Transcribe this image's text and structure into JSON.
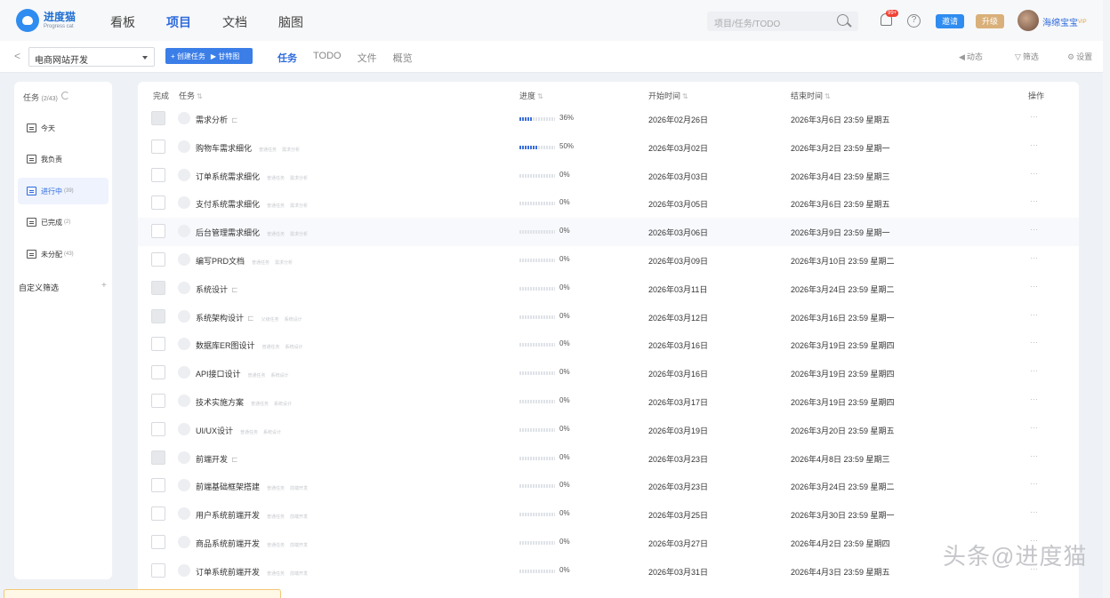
{
  "app": {
    "logo_cn": "进度猫",
    "logo_en": "Progress cat"
  },
  "nav": {
    "items": [
      {
        "label": "看板",
        "active": false
      },
      {
        "label": "项目",
        "active": true
      },
      {
        "label": "文档",
        "active": false
      },
      {
        "label": "脑图",
        "active": false
      }
    ],
    "search_placeholder": "项目/任务/TODO",
    "notif_badge": "99+",
    "help_icon": "?",
    "invite_label": "邀请",
    "upgrade_label": "升级",
    "username": "海绵宝宝",
    "vip_label": "VIP"
  },
  "toolbar": {
    "back_icon": "<",
    "project": "电商网站开发",
    "create_task": "+ 创建任务",
    "gantt": "▶ 甘特图",
    "tabs": [
      {
        "label": "任务",
        "active": true
      },
      {
        "label": "TODO",
        "active": false
      },
      {
        "label": "文件",
        "active": false
      },
      {
        "label": "概览",
        "active": false
      }
    ],
    "activity": "动态",
    "filter": "筛选",
    "settings": "设置"
  },
  "sidebar": {
    "title": "任务",
    "title_count": "(2/43)",
    "items": [
      {
        "label": "今天",
        "count": "",
        "active": false
      },
      {
        "label": "我负责",
        "count": "",
        "active": false
      },
      {
        "label": "进行中",
        "count": "(39)",
        "active": true
      },
      {
        "label": "已完成",
        "count": "(2)",
        "active": false
      },
      {
        "label": "未分配",
        "count": "(43)",
        "active": false
      }
    ],
    "custom_filter": "自定义筛选",
    "custom_add": "+"
  },
  "table": {
    "headers": {
      "done": "完成",
      "task": "任务",
      "progress": "进度",
      "start": "开始时间",
      "end": "结束时间",
      "ops": "操作"
    },
    "rows": [
      {
        "name": "需求分析",
        "subtask": true,
        "tags": [],
        "progress": 36,
        "progress_label": "36%",
        "start": "2026年02月26日",
        "end": "2026年3月6日 23:59 星期五",
        "checkbox": "gray"
      },
      {
        "name": "购物车需求细化",
        "subtask": false,
        "tags": [
          "普通任务",
          "需求分析"
        ],
        "progress": 50,
        "progress_label": "50%",
        "start": "2026年03月02日",
        "end": "2026年3月2日 23:59 星期一",
        "checkbox": "white"
      },
      {
        "name": "订单系统需求细化",
        "subtask": false,
        "tags": [
          "普通任务",
          "需求分析"
        ],
        "progress": 0,
        "progress_label": "0%",
        "start": "2026年03月03日",
        "end": "2026年3月4日 23:59 星期三",
        "checkbox": "white"
      },
      {
        "name": "支付系统需求细化",
        "subtask": false,
        "tags": [
          "普通任务",
          "需求分析"
        ],
        "progress": 0,
        "progress_label": "0%",
        "start": "2026年03月05日",
        "end": "2026年3月6日 23:59 星期五",
        "checkbox": "white"
      },
      {
        "name": "后台管理需求细化",
        "subtask": false,
        "tags": [
          "普通任务",
          "需求分析"
        ],
        "progress": 0,
        "progress_label": "0%",
        "start": "2026年03月06日",
        "end": "2026年3月9日 23:59 星期一",
        "checkbox": "white"
      },
      {
        "name": "编写PRD文档",
        "subtask": false,
        "tags": [
          "普通任务",
          "需求分析"
        ],
        "progress": 0,
        "progress_label": "0%",
        "start": "2026年03月09日",
        "end": "2026年3月10日 23:59 星期二",
        "checkbox": "white"
      },
      {
        "name": "系统设计",
        "subtask": true,
        "tags": [],
        "progress": 0,
        "progress_label": "0%",
        "start": "2026年03月11日",
        "end": "2026年3月24日 23:59 星期二",
        "checkbox": "gray"
      },
      {
        "name": "系统架构设计",
        "subtask": true,
        "tags": [
          "父级任务",
          "系统设计"
        ],
        "progress": 0,
        "progress_label": "0%",
        "start": "2026年03月12日",
        "end": "2026年3月16日 23:59 星期一",
        "checkbox": "gray"
      },
      {
        "name": "数据库ER图设计",
        "subtask": false,
        "tags": [
          "普通任务",
          "系统设计"
        ],
        "progress": 0,
        "progress_label": "0%",
        "start": "2026年03月16日",
        "end": "2026年3月19日 23:59 星期四",
        "checkbox": "white"
      },
      {
        "name": "API接口设计",
        "subtask": false,
        "tags": [
          "普通任务",
          "系统设计"
        ],
        "progress": 0,
        "progress_label": "0%",
        "start": "2026年03月16日",
        "end": "2026年3月19日 23:59 星期四",
        "checkbox": "white"
      },
      {
        "name": "技术实施方案",
        "subtask": false,
        "tags": [
          "普通任务",
          "系统设计"
        ],
        "progress": 0,
        "progress_label": "0%",
        "start": "2026年03月17日",
        "end": "2026年3月19日 23:59 星期四",
        "checkbox": "white"
      },
      {
        "name": "UI/UX设计",
        "subtask": false,
        "tags": [
          "普通任务",
          "系统设计"
        ],
        "progress": 0,
        "progress_label": "0%",
        "start": "2026年03月19日",
        "end": "2026年3月20日 23:59 星期五",
        "checkbox": "white"
      },
      {
        "name": "前端开发",
        "subtask": true,
        "tags": [],
        "progress": 0,
        "progress_label": "0%",
        "start": "2026年03月23日",
        "end": "2026年4月8日 23:59 星期三",
        "checkbox": "gray"
      },
      {
        "name": "前端基础框架搭建",
        "subtask": false,
        "tags": [
          "普通任务",
          "前端开发"
        ],
        "progress": 0,
        "progress_label": "0%",
        "start": "2026年03月23日",
        "end": "2026年3月24日 23:59 星期二",
        "checkbox": "white"
      },
      {
        "name": "用户系统前端开发",
        "subtask": false,
        "tags": [
          "普通任务",
          "前端开发"
        ],
        "progress": 0,
        "progress_label": "0%",
        "start": "2026年03月25日",
        "end": "2026年3月30日 23:59 星期一",
        "checkbox": "white"
      },
      {
        "name": "商品系统前端开发",
        "subtask": false,
        "tags": [
          "普通任务",
          "前端开发"
        ],
        "progress": 0,
        "progress_label": "0%",
        "start": "2026年03月27日",
        "end": "2026年4月2日 23:59 星期四",
        "checkbox": "white"
      },
      {
        "name": "订单系统前端开发",
        "subtask": false,
        "tags": [
          "普通任务",
          "前端开发"
        ],
        "progress": 0,
        "progress_label": "0%",
        "start": "2026年03月31日",
        "end": "2026年4月3日 23:59 星期五",
        "checkbox": "white"
      }
    ],
    "ops_label": "···"
  },
  "watermark": "头条@进度猫"
}
